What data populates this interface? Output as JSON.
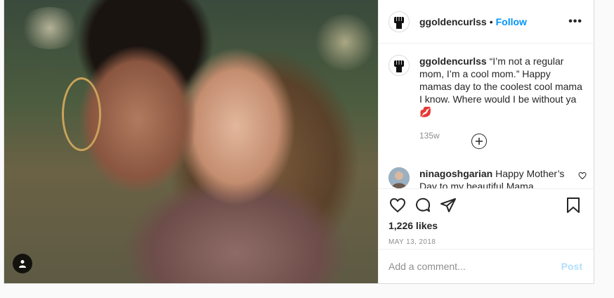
{
  "post": {
    "username": "ggoldencurlss",
    "follow_label": "Follow",
    "separator": "•",
    "more_label": "•••"
  },
  "caption": {
    "username": "ggoldencurlss",
    "text": "“I’m not a regular mom, I’m a cool mom.” Happy mamas day to the coolest cool mama I know. Where would I be without ya💋",
    "timestamp": "135w"
  },
  "comments": [
    {
      "username": "ninagoshgarian",
      "text": "Happy Mother’s Day to my beautiful Mama"
    }
  ],
  "likes": "1,226 likes",
  "date": "MAY 13, 2018",
  "add_comment": {
    "placeholder": "Add a comment...",
    "post_label": "Post"
  },
  "colors": {
    "accent": "#0095f6",
    "post_disabled": "#b2dffc",
    "muted": "#8e8e8e"
  },
  "icons": {
    "header_more": "more-horizontal-icon",
    "load_more": "plus-circle-icon",
    "like": "heart-icon",
    "comment": "comment-bubble-icon",
    "share": "paper-plane-icon",
    "save": "bookmark-icon",
    "tags": "user-tag-icon"
  }
}
